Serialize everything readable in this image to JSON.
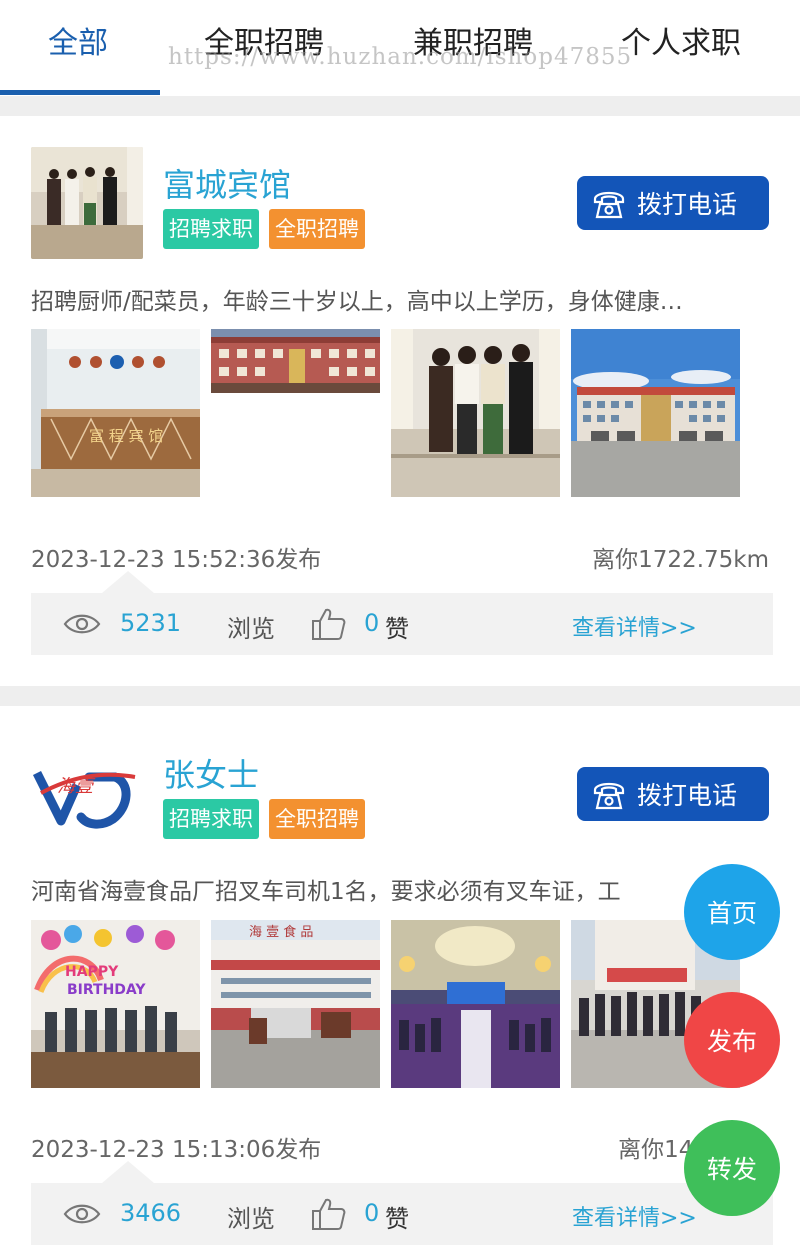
{
  "tabs": [
    {
      "label": "全部"
    },
    {
      "label": "全职招聘"
    },
    {
      "label": "兼职招聘"
    },
    {
      "label": "个人求职"
    }
  ],
  "watermark": "https://www.huzhan.com/ishop47855",
  "posts": [
    {
      "name": "富城宾馆",
      "tags": [
        "招聘求职",
        "全职招聘"
      ],
      "call_label": "拨打电话",
      "description": "招聘厨师/配菜员，年龄三十岁以上，高中以上学历，身体健康…",
      "time": "2023-12-23 15:52:36发布",
      "distance": "离你1722.75km",
      "views": "5231",
      "views_label": "浏览",
      "likes": "0",
      "likes_label": "赞",
      "details_label": "查看详情>>"
    },
    {
      "name": "张女士",
      "tags": [
        "招聘求职",
        "全职招聘"
      ],
      "call_label": "拨打电话",
      "description": "河南省海壹食品厂招叉车司机1名，要求必须有叉车证，工",
      "time": "2023-12-23 15:13:06发布",
      "distance": "离你142",
      "views": "3466",
      "views_label": "浏览",
      "likes": "0",
      "likes_label": "赞",
      "details_label": "查看详情>>",
      "logo_text": "海壹"
    }
  ],
  "fab": {
    "home": "首页",
    "publish": "发布",
    "share": "转发"
  },
  "colors": {
    "accent": "#1a5fae",
    "call_button": "#1355b8",
    "link": "#29a3d3",
    "tag_green": "#2bc9a4",
    "tag_orange": "#f39130"
  }
}
